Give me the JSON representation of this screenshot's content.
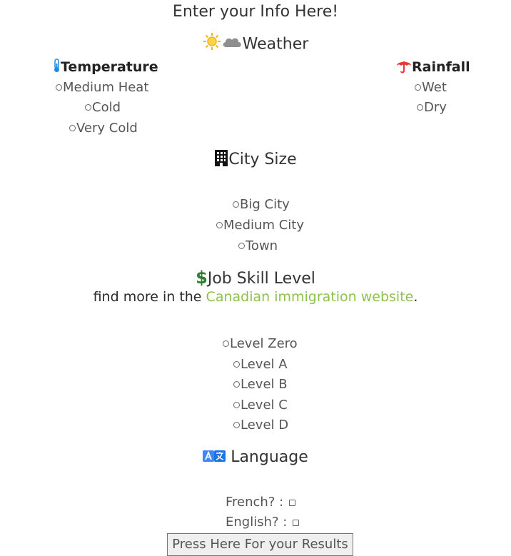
{
  "header": {
    "title": "Enter your Info Here!"
  },
  "weather": {
    "heading": "Weather",
    "icons": [
      "sun-icon",
      "cloud-icon"
    ],
    "temperature": {
      "heading": "Temperature",
      "icon": "thermometer-icon",
      "options": [
        "Medium Heat",
        "Cold",
        "Very Cold"
      ]
    },
    "rainfall": {
      "heading": "Rainfall",
      "icon": "umbrella-icon",
      "options": [
        "Wet",
        "Dry"
      ]
    }
  },
  "city_size": {
    "heading": "City Size",
    "icon": "building-icon",
    "options": [
      "Big City",
      "Medium City",
      "Town"
    ]
  },
  "job_skill": {
    "heading": "Job Skill Level",
    "icon": "dollar-icon",
    "info_prefix": "find more in the ",
    "info_link": "Canadian immigration website",
    "info_suffix": ".",
    "options": [
      "Level Zero",
      "Level A",
      "Level B",
      "Level C",
      "Level D"
    ]
  },
  "language": {
    "heading": " Language",
    "icon": "translate-icon",
    "french_label": "French? : ",
    "english_label": "English? : "
  },
  "submit": {
    "label": "Press Here For your Results"
  },
  "colors": {
    "link": "#8bc34a",
    "dollar": "#2e7d32",
    "umbrella": "#e53935",
    "thermometer": "#1e88e5",
    "translate": "#4285f4"
  }
}
